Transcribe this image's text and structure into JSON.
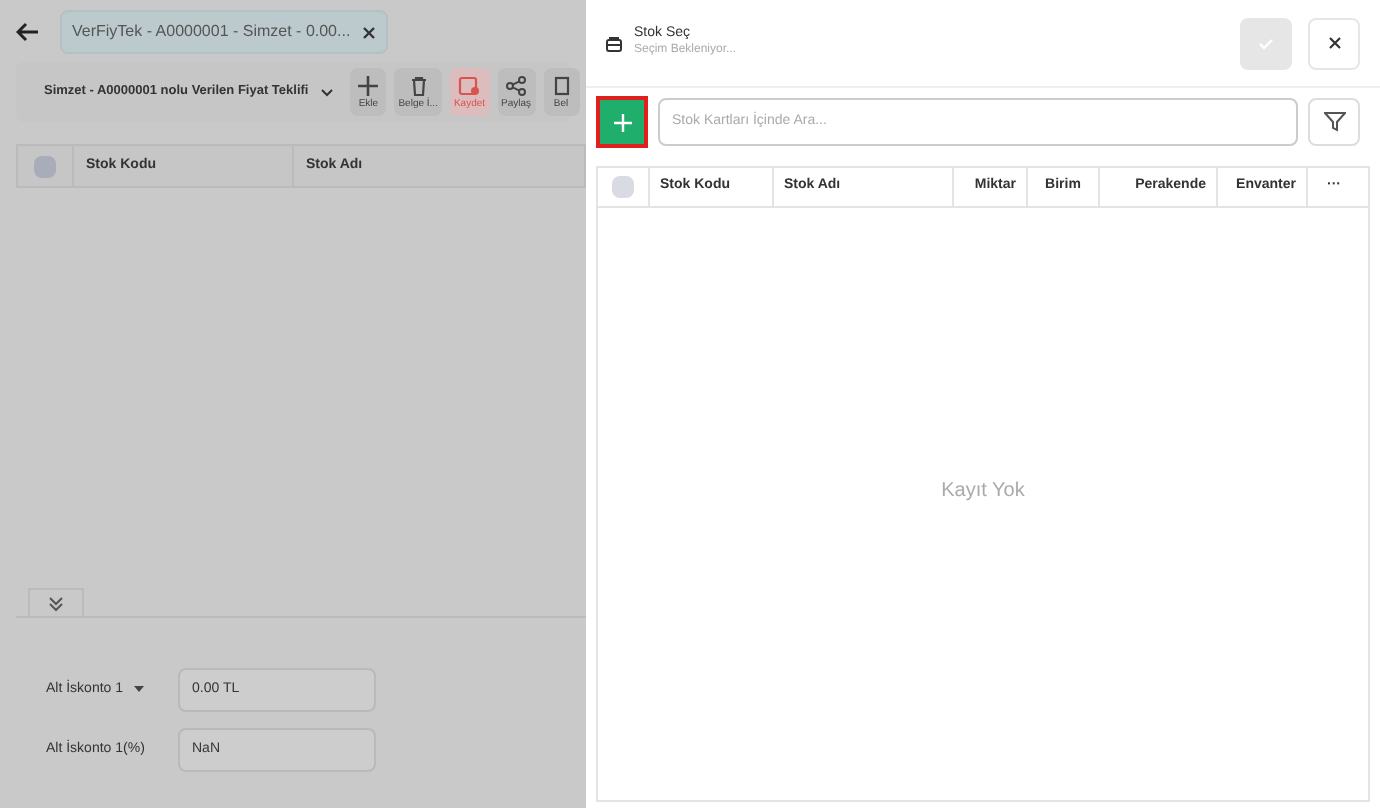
{
  "background_page": {
    "tab": {
      "label": "VerFiyTek - A0000001 - Simzet - 0.00...",
      "closable": true
    },
    "title": "Simzet - A0000001 nolu Verilen Fiyat Teklifi",
    "toolbar": [
      {
        "label": "Ekle",
        "kind": "add"
      },
      {
        "label": "Belge İ...",
        "kind": "delete"
      },
      {
        "label": "Kaydet",
        "kind": "save"
      },
      {
        "label": "Paylaş",
        "kind": "share"
      },
      {
        "label": "Bel",
        "kind": "doc"
      }
    ],
    "table": {
      "select_all_checked": false,
      "columns": [
        "Stok Kodu",
        "Stok Adı"
      ]
    },
    "discounts": [
      {
        "label": "Alt İskonto 1",
        "dropdown": true,
        "value": "0.00 TL"
      },
      {
        "label": "Alt İskonto 1(%)",
        "dropdown": false,
        "value": "NaN"
      }
    ]
  },
  "panel": {
    "title": "Stok Seç",
    "subtitle": "Seçim Bekleniyor...",
    "search": {
      "placeholder": "Stok Kartları İçinde Ara..."
    },
    "table": {
      "select_all_checked": false,
      "columns": [
        "Stok Kodu",
        "Stok Adı",
        "Miktar",
        "Birim",
        "Perakende",
        "Envanter",
        "···"
      ],
      "empty_message": "Kayıt Yok"
    }
  }
}
